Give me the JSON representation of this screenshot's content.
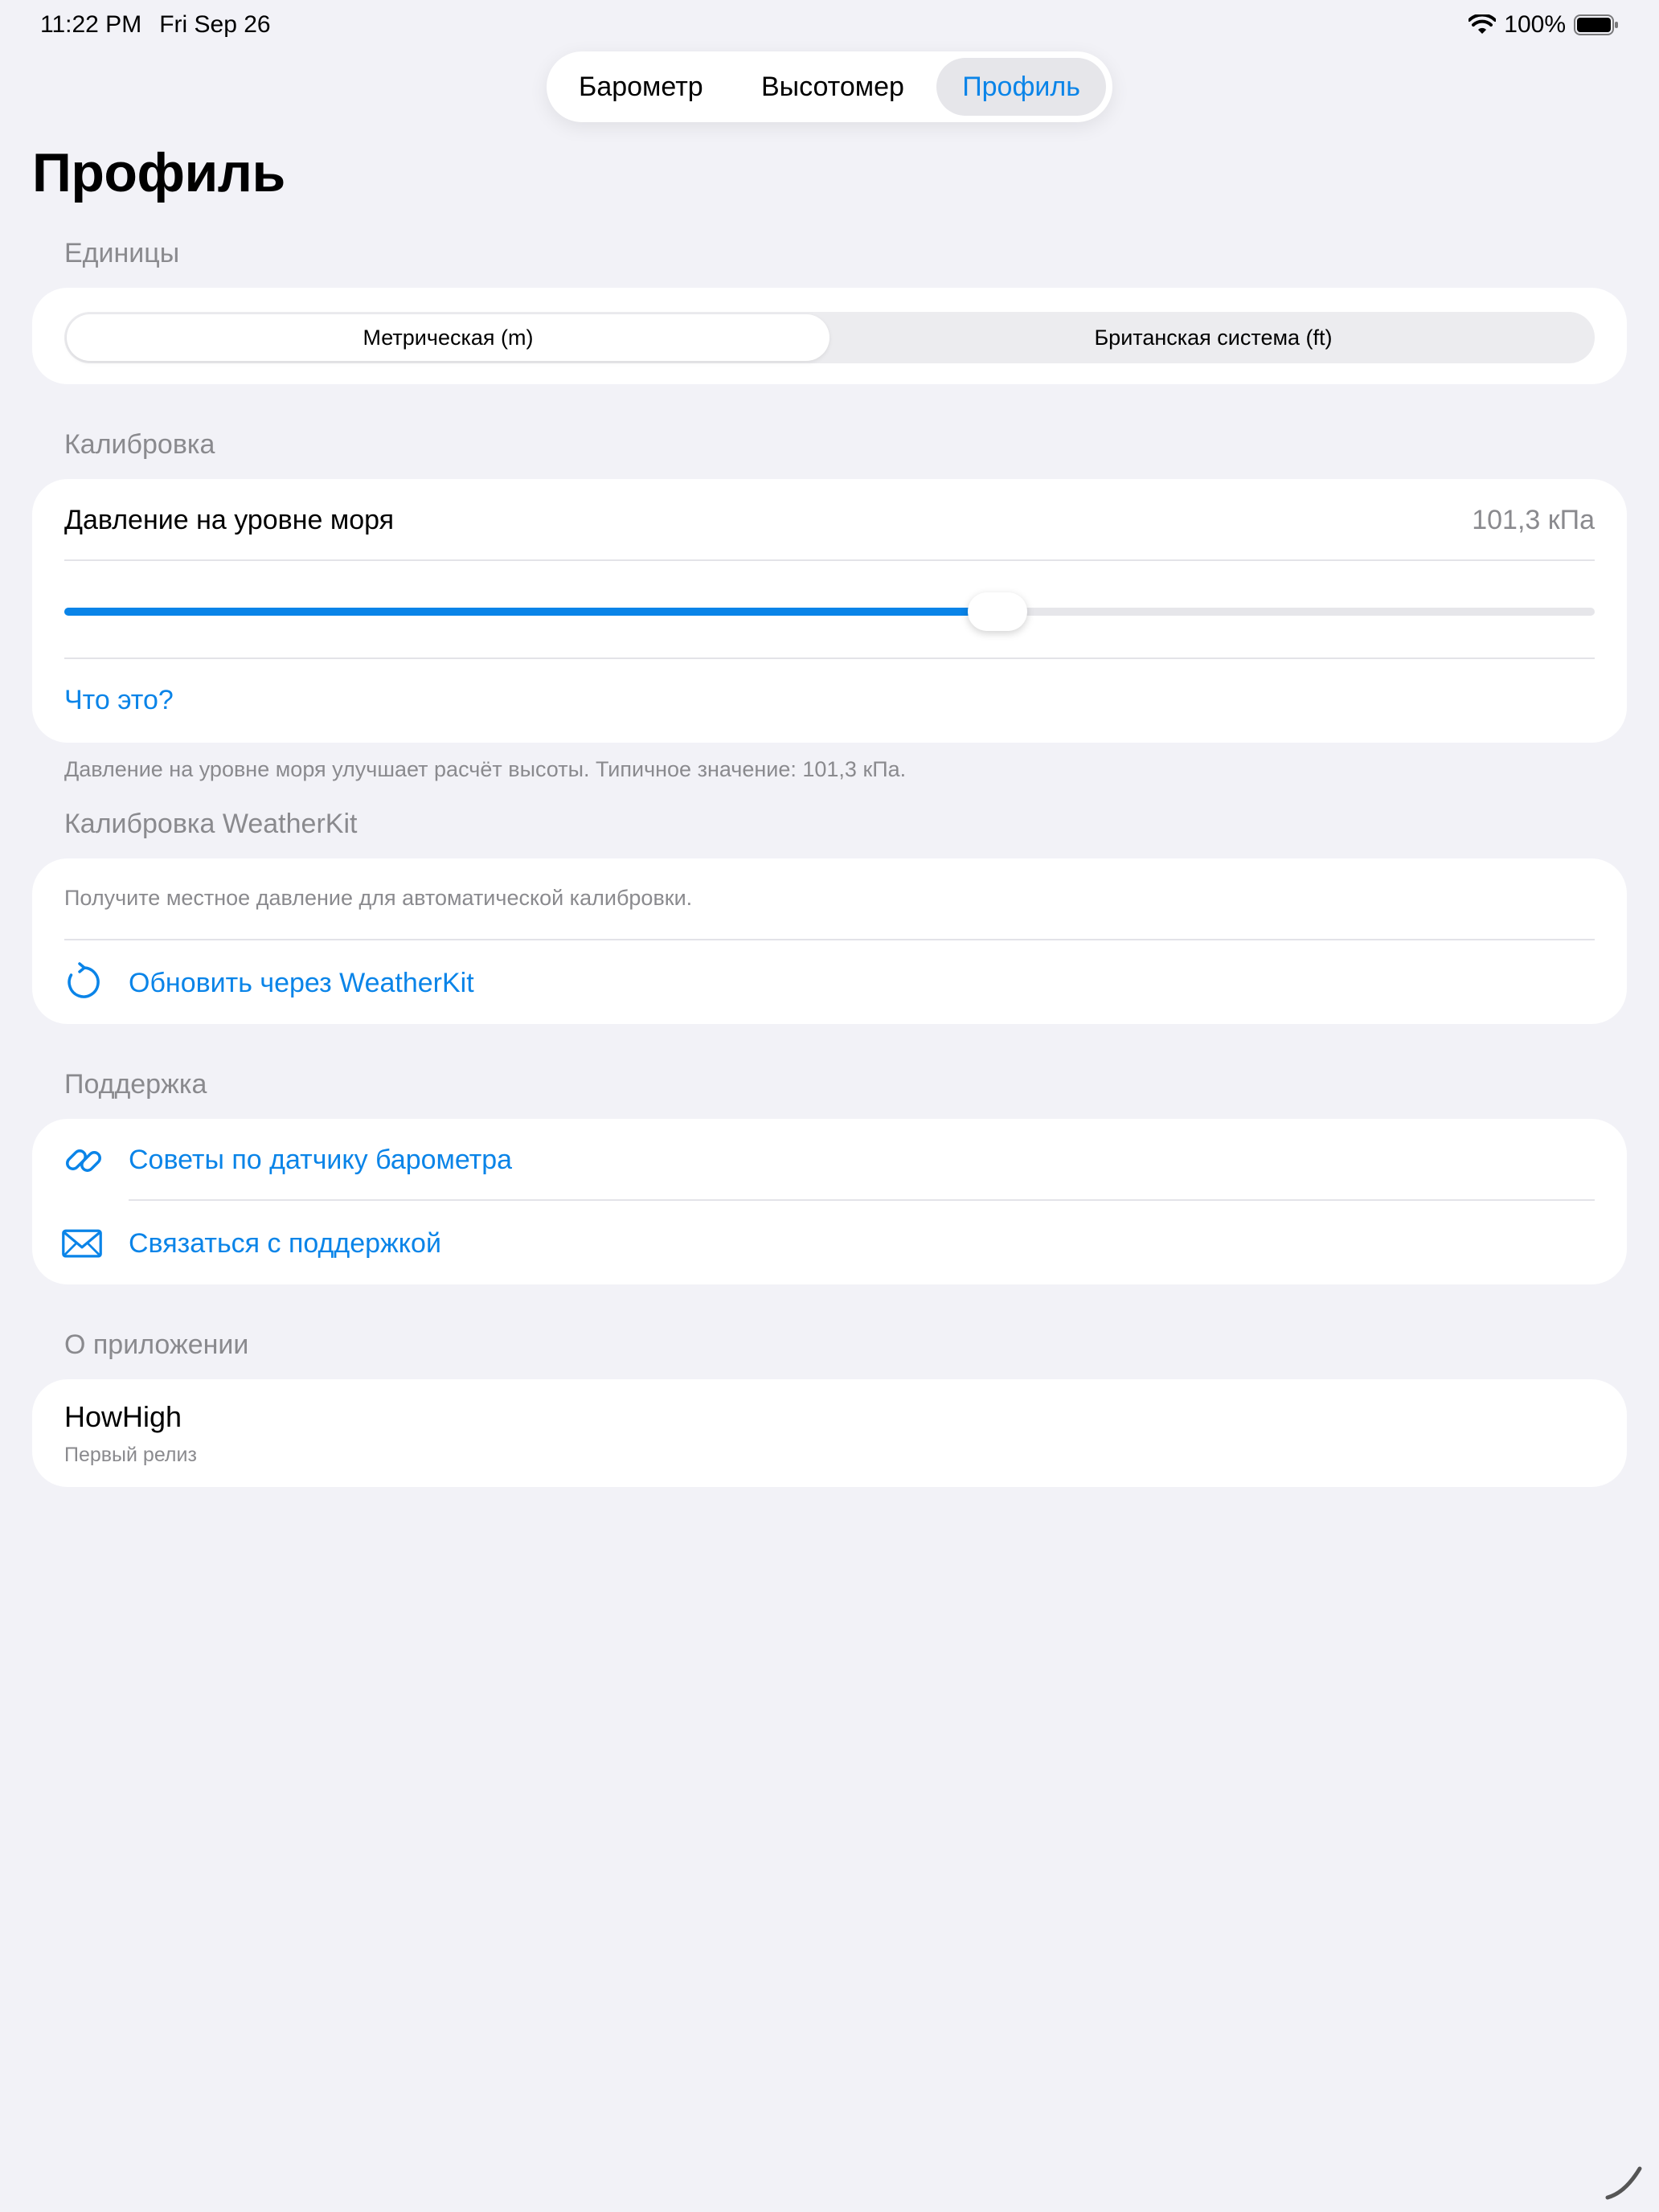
{
  "status_bar": {
    "time": "11:22 PM",
    "date": "Fri Sep 26",
    "battery": "100%"
  },
  "tabs": [
    {
      "label": "Барометр",
      "active": false
    },
    {
      "label": "Высотомер",
      "active": false
    },
    {
      "label": "Профиль",
      "active": true
    }
  ],
  "page_title": "Профиль",
  "units": {
    "header": "Единицы",
    "options": [
      "Метрическая (m)",
      "Британская система (ft)"
    ],
    "selected": "Метрическая (m)"
  },
  "calibration": {
    "header": "Калибровка",
    "label": "Давление на уровне моря",
    "value": "101,3 кПа",
    "slider_fraction": 0.61,
    "help_link": "Что это?",
    "footnote": "Давление на уровне моря улучшает расчёт высоты. Типичное значение: 101,3 кПа."
  },
  "weatherkit": {
    "header": "Калибровка WeatherKit",
    "description": "Получите местное давление для автоматической калибровки.",
    "refresh_label": "Обновить через WeatherKit",
    "icon": "refresh-icon"
  },
  "support": {
    "header": "Поддержка",
    "items": [
      {
        "label": "Советы по датчику барометра",
        "icon": "link-icon"
      },
      {
        "label": "Связаться с поддержкой",
        "icon": "envelope-icon"
      }
    ]
  },
  "about": {
    "header": "О приложении",
    "app_name": "HowHigh",
    "release": "Первый релиз"
  },
  "colors": {
    "accent": "#0a84e8",
    "background": "#f2f2f7",
    "secondary_text": "#8a8a8e"
  }
}
